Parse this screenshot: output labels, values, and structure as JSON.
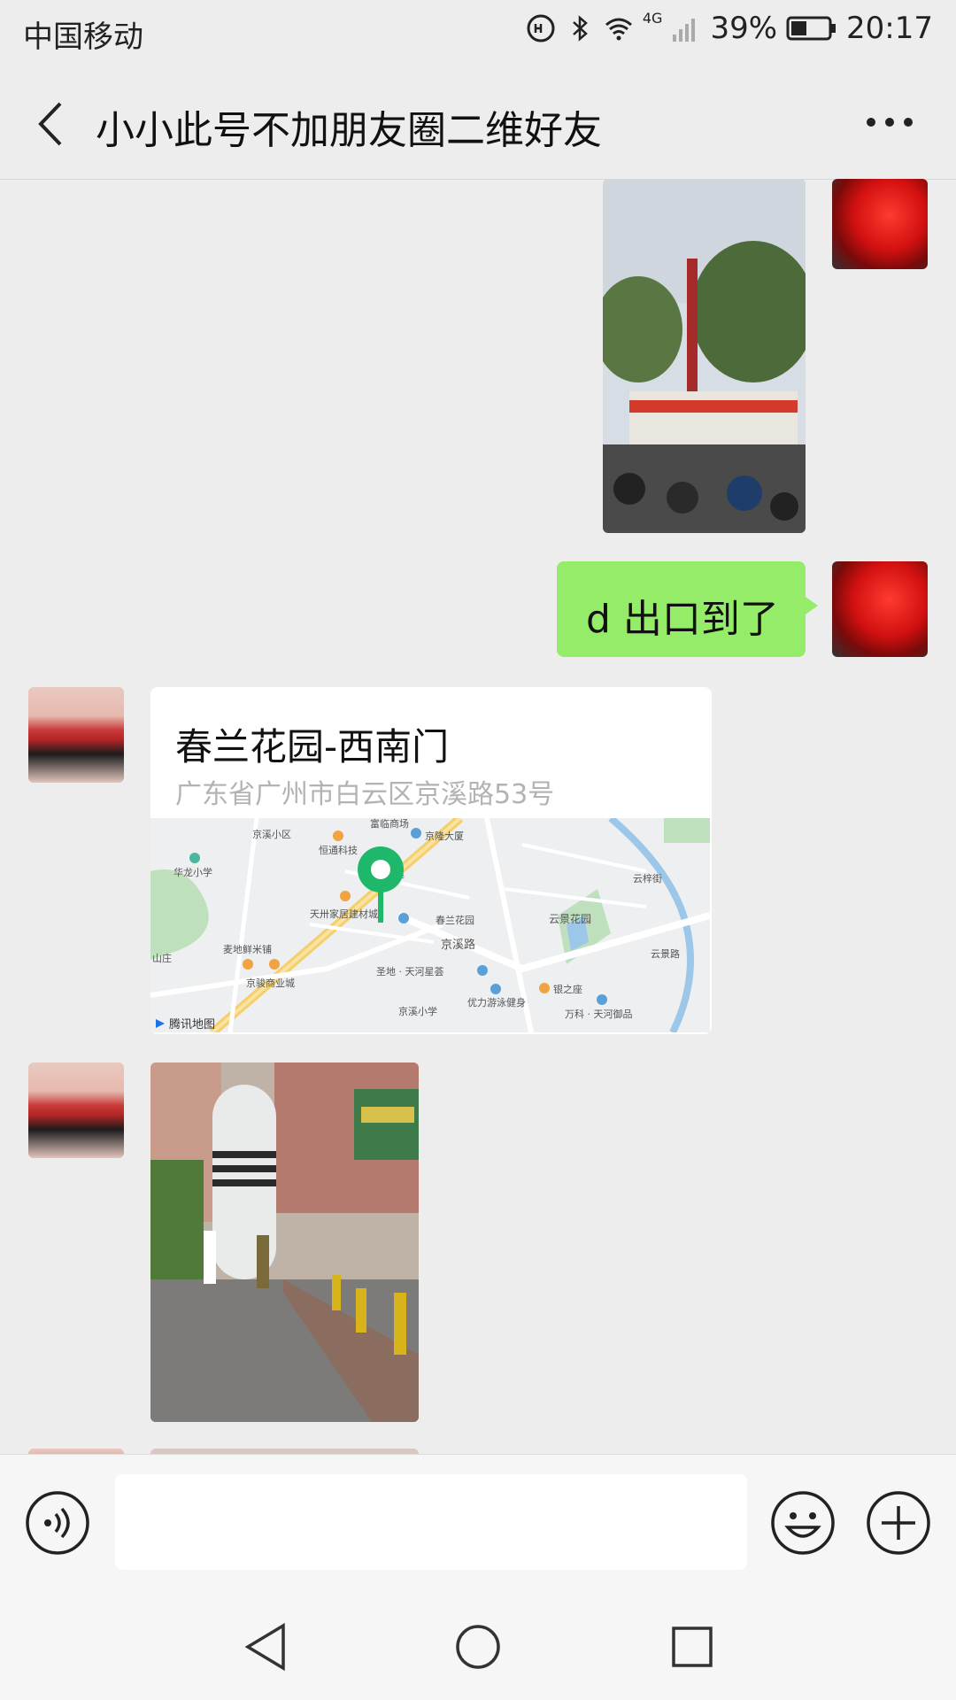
{
  "status_bar": {
    "carrier": "中国移动",
    "network": "4G",
    "battery": "39%",
    "time": "20:17"
  },
  "header": {
    "title": "小小此号不加朋友圈二维好友"
  },
  "messages": {
    "sent_text": "d 出口到了",
    "location": {
      "title": "春兰花园-西南门",
      "address": "广东省广州市白云区京溪路53号",
      "map_labels": {
        "l1": "京溪小区",
        "l2": "富临商场",
        "l3": "京隆大厦",
        "l4": "恒通科技",
        "l5": "华龙小学",
        "l6": "京溪",
        "l7": "天卅家居建材城",
        "l8": "春兰花园",
        "l9": "京溪路",
        "l10": "云景花园",
        "l11": "云梓街",
        "l12": "麦地鲜米铺",
        "l13": "京骏商业城",
        "l14": "圣地 · 天河星荟",
        "l15": "优力游泳健身",
        "l16": "银之座",
        "l17": "京溪小学",
        "l18": "万科 · 天河御品",
        "l19": "云景路",
        "l20": "山庄",
        "brand": "腾讯地图"
      }
    }
  },
  "colors": {
    "bubble_green": "#95ec69",
    "map_pin": "#1fb86b",
    "background": "#ededed"
  }
}
